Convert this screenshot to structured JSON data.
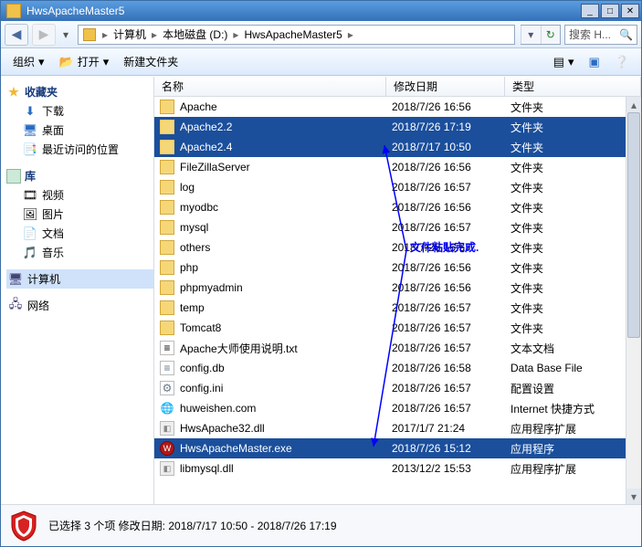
{
  "window": {
    "title": "HwsApacheMaster5"
  },
  "breadcrumb": {
    "parts": [
      "计算机",
      "本地磁盘 (D:)",
      "HwsApacheMaster5"
    ]
  },
  "search": {
    "placeholder": "搜索 H..."
  },
  "toolbar": {
    "organize": "组织",
    "open": "打开",
    "newfolder": "新建文件夹"
  },
  "sidebar": {
    "favorites": {
      "label": "收藏夹"
    },
    "downloads": {
      "label": "下载"
    },
    "desktop": {
      "label": "桌面"
    },
    "recent": {
      "label": "最近访问的位置"
    },
    "libraries": {
      "label": "库"
    },
    "videos": {
      "label": "视频"
    },
    "pictures": {
      "label": "图片"
    },
    "documents": {
      "label": "文档"
    },
    "music": {
      "label": "音乐"
    },
    "computer": {
      "label": "计算机"
    },
    "network": {
      "label": "网络"
    }
  },
  "columns": {
    "name": "名称",
    "date": "修改日期",
    "type": "类型"
  },
  "types": {
    "folder": "文件夹",
    "txt": "文本文档",
    "db": "Data Base File",
    "ini": "配置设置",
    "url": "Internet 快捷方式",
    "dll": "应用程序扩展",
    "exe": "应用程序"
  },
  "files": [
    {
      "n": "Apache",
      "d": "2018/7/26 16:56",
      "t": "folder",
      "sel": false
    },
    {
      "n": "Apache2.2",
      "d": "2018/7/26 17:19",
      "t": "folder",
      "sel": true
    },
    {
      "n": "Apache2.4",
      "d": "2018/7/17 10:50",
      "t": "folder",
      "sel": true
    },
    {
      "n": "FileZillaServer",
      "d": "2018/7/26 16:56",
      "t": "folder",
      "sel": false
    },
    {
      "n": "log",
      "d": "2018/7/26 16:57",
      "t": "folder",
      "sel": false
    },
    {
      "n": "myodbc",
      "d": "2018/7/26 16:56",
      "t": "folder",
      "sel": false
    },
    {
      "n": "mysql",
      "d": "2018/7/26 16:57",
      "t": "folder",
      "sel": false
    },
    {
      "n": "others",
      "d": "2018/7/26 16:57",
      "t": "folder",
      "sel": false
    },
    {
      "n": "php",
      "d": "2018/7/26 16:56",
      "t": "folder",
      "sel": false
    },
    {
      "n": "phpmyadmin",
      "d": "2018/7/26 16:56",
      "t": "folder",
      "sel": false
    },
    {
      "n": "temp",
      "d": "2018/7/26 16:57",
      "t": "folder",
      "sel": false
    },
    {
      "n": "Tomcat8",
      "d": "2018/7/26 16:57",
      "t": "folder",
      "sel": false
    },
    {
      "n": "Apache大师使用说明.txt",
      "d": "2018/7/26 16:57",
      "t": "txt",
      "sel": false
    },
    {
      "n": "config.db",
      "d": "2018/7/26 16:58",
      "t": "db",
      "sel": false
    },
    {
      "n": "config.ini",
      "d": "2018/7/26 16:57",
      "t": "ini",
      "sel": false
    },
    {
      "n": "huweishen.com",
      "d": "2018/7/26 16:57",
      "t": "url",
      "sel": false
    },
    {
      "n": "HwsApache32.dll",
      "d": "2017/1/7 21:24",
      "t": "dll",
      "sel": false
    },
    {
      "n": "HwsApacheMaster.exe",
      "d": "2018/7/26 15:12",
      "t": "exe",
      "sel": true
    },
    {
      "n": "libmysql.dll",
      "d": "2013/12/2 15:53",
      "t": "dll",
      "sel": false
    }
  ],
  "annotation": "文件粘贴完成.",
  "status": {
    "text": "已选择 3 个项 修改日期: 2018/7/17 10:50 - 2018/7/26 17:19"
  }
}
